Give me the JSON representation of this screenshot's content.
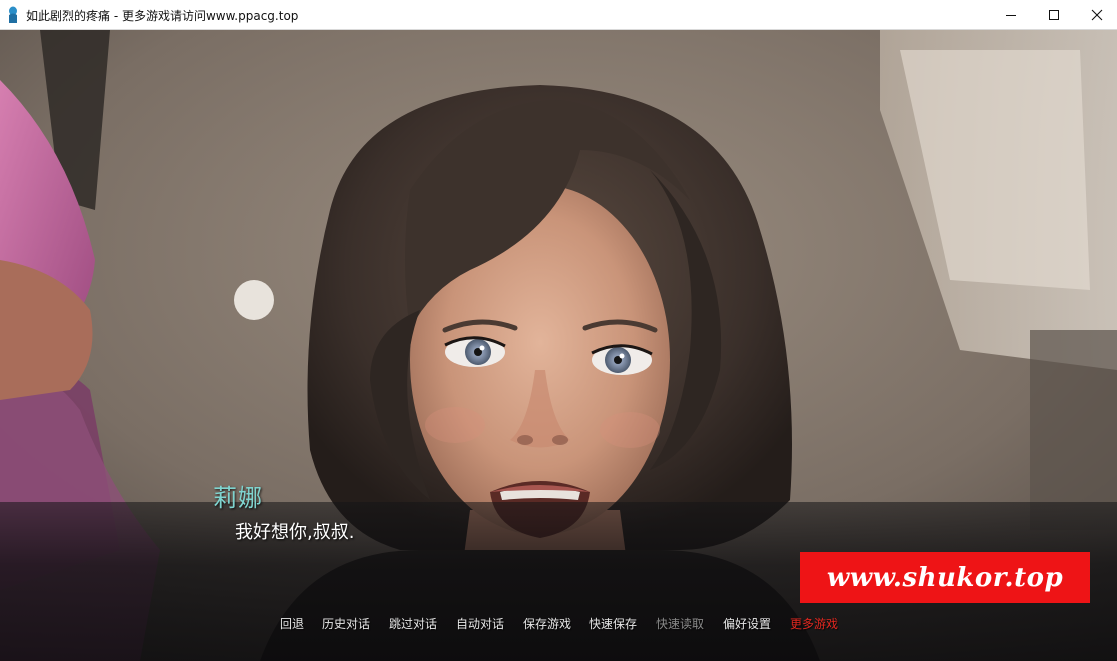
{
  "window": {
    "title": "如此剧烈的疼痛 - 更多游戏请访问www.ppacg.top",
    "icon": "app-icon",
    "controls": {
      "minimize_icon": "minimize-icon",
      "maximize_icon": "maximize-icon",
      "close_icon": "close-icon"
    }
  },
  "scene": {
    "dialogue": {
      "speaker": "莉娜",
      "text": "我好想你,叔叔.",
      "speaker_color": "#7fd4cf"
    },
    "watermark": {
      "text": "www.shukor.top",
      "background": "#ee1416"
    }
  },
  "quick_menu": {
    "items": [
      {
        "label": "回退",
        "state": "normal"
      },
      {
        "label": "历史对话",
        "state": "normal"
      },
      {
        "label": "跳过对话",
        "state": "normal"
      },
      {
        "label": "自动对话",
        "state": "normal"
      },
      {
        "label": "保存游戏",
        "state": "normal"
      },
      {
        "label": "快速保存",
        "state": "normal"
      },
      {
        "label": "快速读取",
        "state": "disabled"
      },
      {
        "label": "偏好设置",
        "state": "normal"
      },
      {
        "label": "更多游戏",
        "state": "highlight"
      }
    ],
    "colors": {
      "normal": "#e6e6e6",
      "disabled": "#8a8a8a",
      "highlight": "#e0271f"
    }
  }
}
